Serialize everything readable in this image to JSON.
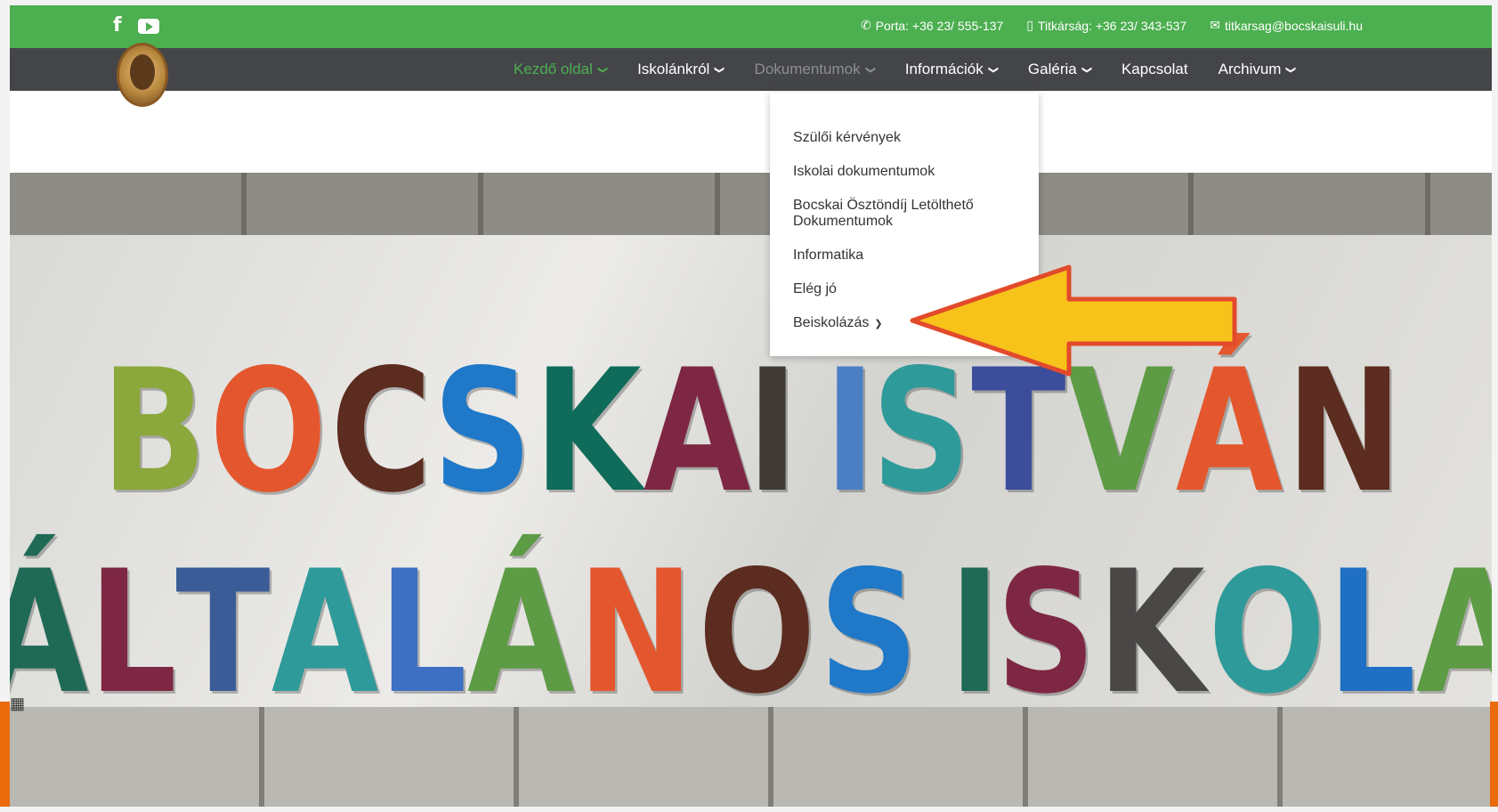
{
  "topbar": {
    "social": [
      {
        "icon": "facebook-icon",
        "label": "f"
      },
      {
        "icon": "youtube-icon"
      }
    ],
    "contacts": [
      {
        "icon": "phone-icon",
        "glyph": "✆",
        "text": "Porta: +36 23/ 555-137"
      },
      {
        "icon": "mobile-icon",
        "glyph": "▯",
        "text": "Titkárság: +36 23/ 343-537"
      },
      {
        "icon": "envelope-icon",
        "glyph": "✉",
        "text": "titkarsag@bocskaisuli.hu"
      }
    ]
  },
  "nav": {
    "items": [
      {
        "label": "Kezdő oldal",
        "state": "active"
      },
      {
        "label": "Iskolánkról",
        "state": "normal"
      },
      {
        "label": "Dokumentumok",
        "state": "hover"
      },
      {
        "label": "Információk",
        "state": "normal"
      },
      {
        "label": "Galéria",
        "state": "normal"
      },
      {
        "label": "Kapcsolat",
        "state": "normal"
      },
      {
        "label": "Archivum",
        "state": "normal"
      }
    ],
    "chevron": "❯"
  },
  "dropdown": {
    "items": [
      {
        "label": "Szülői kérvények"
      },
      {
        "label": "Iskolai dokumentumok"
      },
      {
        "label": "Bocskai Ösztöndíj Letölthető Dokumentumok"
      },
      {
        "label": "Informatika"
      },
      {
        "label": "Elég jó"
      },
      {
        "label": "Beiskolázás"
      }
    ],
    "submenu_chevron": "❯"
  },
  "hero": {
    "line1": "BOCSKAI ISTVÁN",
    "line2": "ÁLTALÁNOS ISKOLA",
    "letter_colors": {
      "line1": [
        "#8aa83b",
        "#e4572e",
        "#5b2c1f",
        "#1f78c8",
        "#0f6b5a",
        "#7e2744",
        "#3f3a36",
        " ",
        "#4a7fc4",
        "#2f9a9a",
        "#3c4d9c",
        "#5d9b44",
        "#e4572e",
        "#5b2c1f",
        "#1f6fc4"
      ],
      "line2": [
        "#1f6a55",
        "#7e2744",
        "#3a5c97",
        "#2f9a9a",
        "#3d70c2",
        "#5d9b44",
        "#e4572e",
        "#5b2c1f",
        "#1f78c8",
        " ",
        "#1f6a55",
        "#7e2744",
        "#4a4747",
        "#2f9a9a",
        "#1f6fc4",
        "#5d9b44"
      ]
    }
  },
  "annotation": {
    "type": "arrow-pointer",
    "fill": "#f7c21a",
    "stroke": "#e24a2c"
  }
}
